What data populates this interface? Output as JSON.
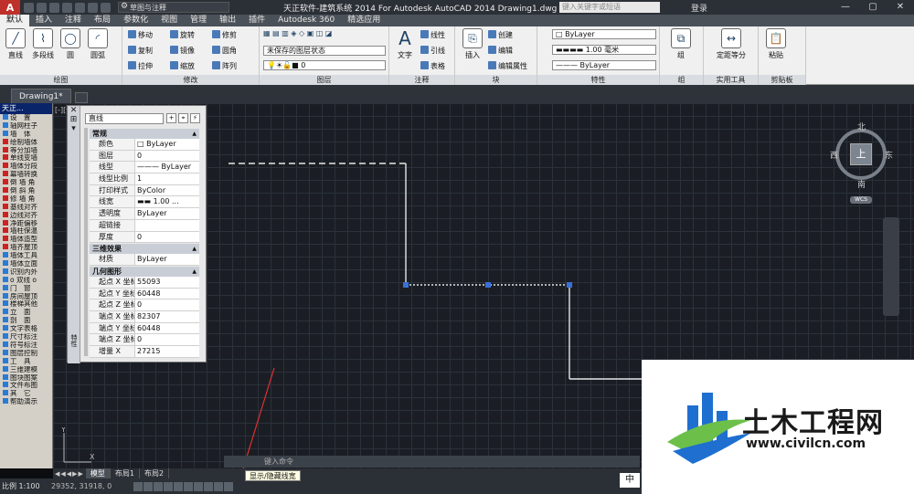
{
  "titlebar": {
    "app_button": "A",
    "workspace": "草图与注释",
    "title": "天正软件-建筑系统 2014  For Autodesk AutoCAD 2014    Drawing1.dwg",
    "search_placeholder": "键入关键字或短语",
    "login": "登录"
  },
  "tabs": [
    "默认",
    "插入",
    "注释",
    "布局",
    "参数化",
    "视图",
    "管理",
    "输出",
    "插件",
    "Autodesk 360",
    "精选应用"
  ],
  "ribbon": {
    "draw": {
      "title": "绘图",
      "tools": [
        "直线",
        "多段线",
        "圆",
        "圆弧"
      ]
    },
    "modify": {
      "title": "修改",
      "rows": [
        [
          "移动",
          "旋转",
          "修剪"
        ],
        [
          "复制",
          "镜像",
          "圆角"
        ],
        [
          "拉伸",
          "缩放",
          "阵列"
        ]
      ]
    },
    "layer": {
      "title": "图层",
      "dropdown": "未保存的图层状态",
      "current": "0"
    },
    "annotation": {
      "title": "注释",
      "big": "文字",
      "rows": [
        "线性",
        "引线",
        "表格"
      ]
    },
    "block": {
      "title": "块",
      "big": "插入",
      "rows": [
        "创建",
        "编辑",
        "编辑属性"
      ]
    },
    "properties": {
      "title": "特性",
      "color": "ByLayer",
      "lineweight": "1.00 毫米",
      "linetype": "ByLayer"
    },
    "groups": {
      "title": "组",
      "big": "组"
    },
    "utilities": {
      "title": "实用工具",
      "big": "定距等分"
    },
    "clipboard": {
      "title": "剪贴板",
      "big": "粘贴"
    }
  },
  "doc_tab": "Drawing1*",
  "viewport_label": "[-][俯视][二维线框]",
  "tianzheng": {
    "header": "天正...",
    "items": [
      {
        "label": "设　置",
        "color": "#2a7bd5"
      },
      {
        "label": "轴网柱子",
        "color": "#2a7bd5"
      },
      {
        "label": "墙　体",
        "color": "#2a7bd5"
      },
      {
        "label": "绘制墙体",
        "color": "#cc2222"
      },
      {
        "label": "等分加墙",
        "color": "#cc2222"
      },
      {
        "label": "单线变墙",
        "color": "#cc2222"
      },
      {
        "label": "墙体分段",
        "color": "#cc2222"
      },
      {
        "label": "幕墙转换",
        "color": "#cc2222"
      },
      {
        "label": "倒 墙 角",
        "color": "#cc2222"
      },
      {
        "label": "倒 斜 角",
        "color": "#cc2222"
      },
      {
        "label": "修 墙 角",
        "color": "#cc2222"
      },
      {
        "label": "基线对齐",
        "color": "#cc2222"
      },
      {
        "label": "边线对齐",
        "color": "#cc2222"
      },
      {
        "label": "净距偏移",
        "color": "#cc2222"
      },
      {
        "label": "墙柱保温",
        "color": "#cc2222"
      },
      {
        "label": "墙体造型",
        "color": "#cc2222"
      },
      {
        "label": "墙齐屋顶",
        "color": "#cc2222"
      },
      {
        "label": "墙体工具",
        "color": "#2a7bd5"
      },
      {
        "label": "墙体立面",
        "color": "#2a7bd5"
      },
      {
        "label": "识别内外",
        "color": "#2a7bd5"
      },
      {
        "label": "o 双线 o",
        "color": "#2a7bd5"
      },
      {
        "label": "门　窗",
        "color": "#2a7bd5"
      },
      {
        "label": "房间屋顶",
        "color": "#2a7bd5"
      },
      {
        "label": "楼梯其他",
        "color": "#2a7bd5"
      },
      {
        "label": "立　面",
        "color": "#2a7bd5"
      },
      {
        "label": "剖　面",
        "color": "#2a7bd5"
      },
      {
        "label": "文字表格",
        "color": "#2a7bd5"
      },
      {
        "label": "尺寸标注",
        "color": "#2a7bd5"
      },
      {
        "label": "符号标注",
        "color": "#2a7bd5"
      },
      {
        "label": "图层控制",
        "color": "#2a7bd5"
      },
      {
        "label": "工　具",
        "color": "#2a7bd5"
      },
      {
        "label": "三维建模",
        "color": "#2a7bd5"
      },
      {
        "label": "图块图案",
        "color": "#2a7bd5"
      },
      {
        "label": "文件布图",
        "color": "#2a7bd5"
      },
      {
        "label": "其　它",
        "color": "#2a7bd5"
      },
      {
        "label": "帮助演示",
        "color": "#2a7bd5"
      }
    ]
  },
  "properties_panel": {
    "selected": "直线",
    "side_label": "特性",
    "sections": [
      {
        "title": "常规",
        "rows": [
          [
            "颜色",
            "□ ByLayer"
          ],
          [
            "图层",
            "0"
          ],
          [
            "线型",
            "——— ByLayer"
          ],
          [
            "线型比例",
            "1"
          ],
          [
            "打印样式",
            "ByColor"
          ],
          [
            "线宽",
            "▬▬ 1.00 ..."
          ],
          [
            "透明度",
            "ByLayer"
          ],
          [
            "超链接",
            ""
          ],
          [
            "厚度",
            "0"
          ]
        ]
      },
      {
        "title": "三维效果",
        "rows": [
          [
            "材质",
            "ByLayer"
          ]
        ]
      },
      {
        "title": "几何图形",
        "rows": [
          [
            "起点 X 坐标",
            "55093"
          ],
          [
            "起点 Y 坐标",
            "60448"
          ],
          [
            "起点 Z 坐标",
            "0"
          ],
          [
            "端点 X 坐标",
            "82307"
          ],
          [
            "端点 Y 坐标",
            "60448"
          ],
          [
            "端点 Z 坐标",
            "0"
          ],
          [
            "增量 X",
            "27215"
          ]
        ]
      }
    ]
  },
  "viewcube": {
    "north": "北",
    "south": "南",
    "east": "东",
    "west": "西",
    "top": "上",
    "wcs": "WCS"
  },
  "command_placeholder": "键入命令",
  "layout_tabs": [
    "模型",
    "布局1",
    "布局2"
  ],
  "status": {
    "scale": "比例 1:100",
    "coords": "29352, 31918, 0",
    "ime": "中"
  },
  "tooltip": "显示/隐藏线宽",
  "watermark": {
    "cn": "土木工程网",
    "url": "www.civilcn.com"
  },
  "colors": {
    "accent": "#c0302a",
    "grip": "#3a6fd8",
    "watermark_blue": "#1e6fd0"
  }
}
